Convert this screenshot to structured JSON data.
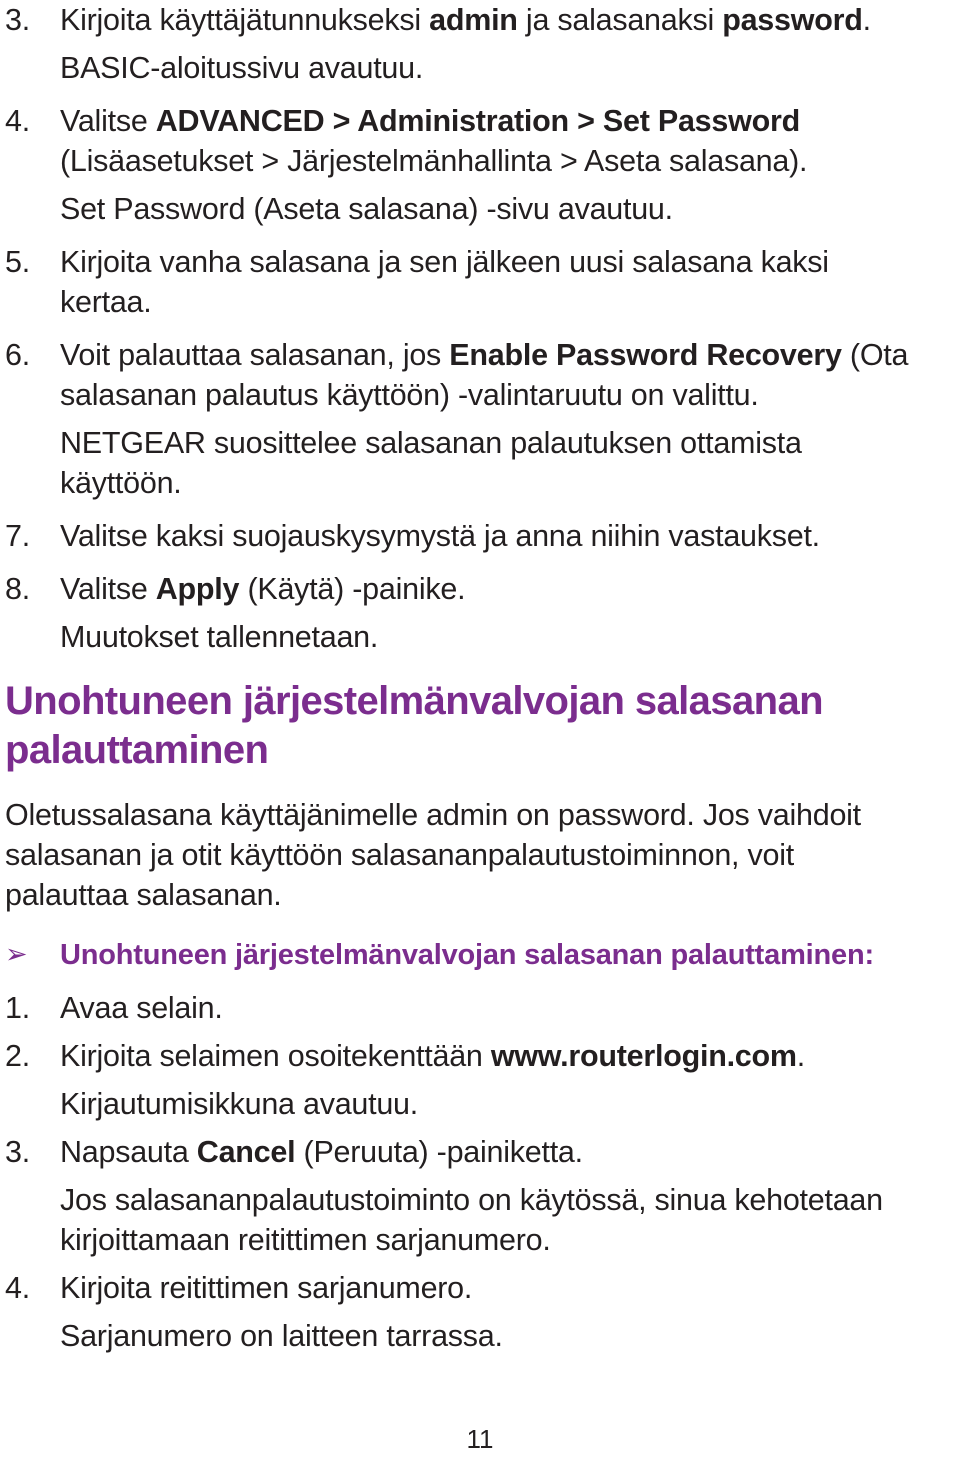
{
  "document": {
    "language": "fi",
    "page_number": "11",
    "accent_color": "#7b2d8e",
    "text_color": "#231f20",
    "background_color": "#ffffff"
  },
  "steps_top": [
    {
      "number": "3.",
      "text_parts": [
        {
          "text": "Kirjoita käyttäjätunnukseksi ",
          "bold": false
        },
        {
          "text": "admin",
          "bold": true
        },
        {
          "text": " ja salasanaksi ",
          "bold": false
        },
        {
          "text": "password",
          "bold": true
        },
        {
          "text": ".",
          "bold": false
        }
      ],
      "plain": "Kirjoita käyttäjätunnukseksi admin ja salasanaksi password.",
      "sublines": [
        "BASIC-aloitussivu avautuu."
      ]
    },
    {
      "number": "4.",
      "text_parts": [
        {
          "text": "Valitse ",
          "bold": false
        },
        {
          "text": "ADVANCED > Administration > Set Password",
          "bold": true
        }
      ],
      "plain": "Valitse ADVANCED > Administration > Set Password",
      "continuation": "(Lisäasetukset > Järjestelmänhallinta > Aseta salasana).",
      "sublines": [
        "Set Password (Aseta salasana) -sivu avautuu."
      ]
    },
    {
      "number": "5.",
      "text_parts": [
        {
          "text": "Kirjoita vanha salasana ja sen jälkeen uusi salasana kaksi kertaa.",
          "bold": false
        }
      ],
      "plain": "Kirjoita vanha salasana ja sen jälkeen uusi salasana kaksi kertaa.",
      "sublines": []
    },
    {
      "number": "6.",
      "text_parts": [
        {
          "text": "Voit palauttaa salasanan, jos ",
          "bold": false
        },
        {
          "text": "Enable Password Recovery",
          "bold": true
        },
        {
          "text": " (Ota salasanan palautus käyttöön) -valintaruutu on valittu.",
          "bold": false
        }
      ],
      "plain": "Voit palauttaa salasanan, jos Enable Password Recovery (Ota salasanan palautus käyttöön) -valintaruutu on valittu.",
      "sublines": [
        "NETGEAR suosittelee salasanan palautuksen ottamista käyttöön."
      ]
    },
    {
      "number": "7.",
      "text_parts": [
        {
          "text": "Valitse kaksi suojauskysymystä ja anna niihin vastaukset.",
          "bold": false
        }
      ],
      "plain": "Valitse kaksi suojauskysymystä ja anna niihin vastaukset.",
      "sublines": []
    },
    {
      "number": "8.",
      "text_parts": [
        {
          "text": "Valitse ",
          "bold": false
        },
        {
          "text": "Apply",
          "bold": true
        },
        {
          "text": " (Käytä) -painike.",
          "bold": false
        }
      ],
      "plain": "Valitse Apply (Käytä) -painike.",
      "sublines": [
        "Muutokset tallennetaan."
      ]
    }
  ],
  "section": {
    "heading": "Unohtuneen järjestelmänvalvojan salasanan palauttaminen",
    "intro": "Oletussalasana käyttäjänimelle admin on password. Jos vaihdoit salasanan ja otit käyttöön salasananpalautustoiminnon, voit palauttaa salasanan.",
    "arrow_bullet_glyph": "➢",
    "arrow_heading": "Unohtuneen järjestelmänvalvojan salasanan palauttaminen:"
  },
  "steps_bottom": [
    {
      "number": "1.",
      "text_parts": [
        {
          "text": "Avaa selain.",
          "bold": false
        }
      ],
      "plain": "Avaa selain.",
      "sublines": []
    },
    {
      "number": "2.",
      "text_parts": [
        {
          "text": "Kirjoita selaimen osoitekenttään ",
          "bold": false
        },
        {
          "text": "www.routerlogin.com",
          "bold": true
        },
        {
          "text": ".",
          "bold": false
        }
      ],
      "plain": "Kirjoita selaimen osoitekenttään www.routerlogin.com.",
      "sublines": [
        "Kirjautumisikkuna avautuu."
      ]
    },
    {
      "number": "3.",
      "text_parts": [
        {
          "text": "Napsauta ",
          "bold": false
        },
        {
          "text": "Cancel",
          "bold": true
        },
        {
          "text": " (Peruuta) -painiketta.",
          "bold": false
        }
      ],
      "plain": "Napsauta Cancel (Peruuta) -painiketta.",
      "sublines": [
        "Jos salasananpalautustoiminto on käytössä, sinua kehotetaan kirjoittamaan reitittimen sarjanumero."
      ]
    },
    {
      "number": "4.",
      "text_parts": [
        {
          "text": "Kirjoita reitittimen sarjanumero.",
          "bold": false
        }
      ],
      "plain": "Kirjoita reitittimen sarjanumero.",
      "sublines": [
        "Sarjanumero on laitteen tarrassa."
      ]
    }
  ]
}
